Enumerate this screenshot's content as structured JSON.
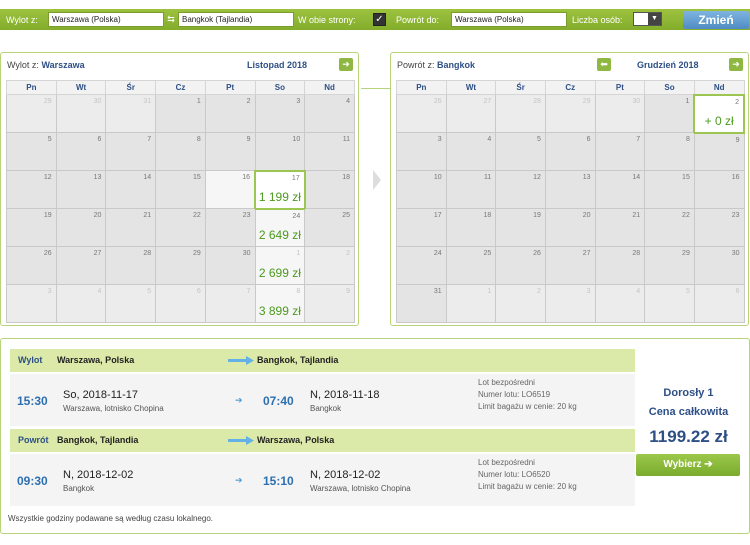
{
  "search": {
    "from_label": "Wylot z:",
    "from_value": "Warszawa (Polska)",
    "to_value": "Bangkok (Tajlandia)",
    "roundtrip_label": "W obie strony:",
    "roundtrip_checked": "✓",
    "return_label": "Powrót do:",
    "return_value": "Warszawa (Polska)",
    "persons_label": "Liczba osób:",
    "persons_value": "1",
    "submit_label": "Zmień"
  },
  "outbound_calendar": {
    "title_prefix": "Wylot z:",
    "city": "Warszawa",
    "month": "Listopad 2018",
    "weekdays": [
      "Pn",
      "Wt",
      "Śr",
      "Cz",
      "Pt",
      "So",
      "Nd"
    ],
    "weeks": [
      [
        {
          "d": "29",
          "dim": true
        },
        {
          "d": "30",
          "dim": true
        },
        {
          "d": "31",
          "dim": true
        },
        {
          "d": "1"
        },
        {
          "d": "2"
        },
        {
          "d": "3"
        },
        {
          "d": "4"
        }
      ],
      [
        {
          "d": "5"
        },
        {
          "d": "6"
        },
        {
          "d": "7"
        },
        {
          "d": "8"
        },
        {
          "d": "9"
        },
        {
          "d": "10"
        },
        {
          "d": "11"
        }
      ],
      [
        {
          "d": "12"
        },
        {
          "d": "13"
        },
        {
          "d": "14"
        },
        {
          "d": "15"
        },
        {
          "d": "16",
          "white": true
        },
        {
          "d": "17",
          "price": "1 199 zł",
          "sel": true
        },
        {
          "d": "18"
        }
      ],
      [
        {
          "d": "19"
        },
        {
          "d": "20"
        },
        {
          "d": "21"
        },
        {
          "d": "22"
        },
        {
          "d": "23"
        },
        {
          "d": "24",
          "price": "2 649 zł",
          "white": true
        },
        {
          "d": "25"
        }
      ],
      [
        {
          "d": "26"
        },
        {
          "d": "27"
        },
        {
          "d": "28"
        },
        {
          "d": "29"
        },
        {
          "d": "30"
        },
        {
          "d": "1",
          "price": "2 699 zł",
          "dim": true,
          "white": true
        },
        {
          "d": "2",
          "dim": true
        }
      ],
      [
        {
          "d": "3",
          "dim": true
        },
        {
          "d": "4",
          "dim": true
        },
        {
          "d": "5",
          "dim": true
        },
        {
          "d": "6",
          "dim": true
        },
        {
          "d": "7",
          "dim": true
        },
        {
          "d": "8",
          "price": "3 899 zł",
          "dim": true,
          "white": true
        },
        {
          "d": "9",
          "dim": true
        }
      ]
    ]
  },
  "return_calendar": {
    "title_prefix": "Powrót z:",
    "city": "Bangkok",
    "month": "Grudzień 2018",
    "weekdays": [
      "Pn",
      "Wt",
      "Śr",
      "Cz",
      "Pt",
      "So",
      "Nd"
    ],
    "weeks": [
      [
        {
          "d": "26",
          "dim": true
        },
        {
          "d": "27",
          "dim": true
        },
        {
          "d": "28",
          "dim": true
        },
        {
          "d": "29",
          "dim": true
        },
        {
          "d": "30",
          "dim": true
        },
        {
          "d": "1"
        },
        {
          "d": "2",
          "price": "+ 0 zł",
          "sel": true
        }
      ],
      [
        {
          "d": "3"
        },
        {
          "d": "4"
        },
        {
          "d": "5"
        },
        {
          "d": "6"
        },
        {
          "d": "7"
        },
        {
          "d": "8"
        },
        {
          "d": "9"
        }
      ],
      [
        {
          "d": "10"
        },
        {
          "d": "11"
        },
        {
          "d": "12"
        },
        {
          "d": "13"
        },
        {
          "d": "14"
        },
        {
          "d": "15"
        },
        {
          "d": "16"
        }
      ],
      [
        {
          "d": "17"
        },
        {
          "d": "18"
        },
        {
          "d": "19"
        },
        {
          "d": "20"
        },
        {
          "d": "21"
        },
        {
          "d": "22"
        },
        {
          "d": "23"
        }
      ],
      [
        {
          "d": "24"
        },
        {
          "d": "25"
        },
        {
          "d": "26"
        },
        {
          "d": "27"
        },
        {
          "d": "28"
        },
        {
          "d": "29"
        },
        {
          "d": "30"
        }
      ],
      [
        {
          "d": "31"
        },
        {
          "d": "1",
          "dim": true
        },
        {
          "d": "2",
          "dim": true
        },
        {
          "d": "3",
          "dim": true
        },
        {
          "d": "4",
          "dim": true
        },
        {
          "d": "5",
          "dim": true
        },
        {
          "d": "6",
          "dim": true
        }
      ]
    ]
  },
  "outbound": {
    "label": "Wylot",
    "from": "Warszawa, Polska",
    "to": "Bangkok, Tajlandia",
    "dep_time": "15:30",
    "dep_date": "So, 2018-11-17",
    "dep_place": "Warszawa, lotnisko Chopina",
    "arr_time": "07:40",
    "arr_date": "N, 2018-11-18",
    "arr_place": "Bangkok",
    "type": "Lot bezpośredni",
    "flight_no": "Numer lotu: LO6519",
    "baggage": "Limit bagażu w cenie: 20 kg"
  },
  "inbound": {
    "label": "Powrót",
    "from": "Bangkok, Tajlandia",
    "to": "Warszawa, Polska",
    "dep_time": "09:30",
    "dep_date": "N, 2018-12-02",
    "dep_place": "Bangkok",
    "arr_time": "15:10",
    "arr_date": "N, 2018-12-02",
    "arr_place": "Warszawa, lotnisko Chopina",
    "type": "Lot bezpośredni",
    "flight_no": "Numer lotu: LO6520",
    "baggage": "Limit bagażu w cenie: 20 kg"
  },
  "price": {
    "pax": "Dorosły 1",
    "total_label": "Cena całkowita",
    "total": "1199.22 zł",
    "select_label": "Wybierz"
  },
  "footer_note": "Wszystkie godziny podawane są według czasu lokalnego.",
  "colors": {
    "accent_green": "#8fb843",
    "brand_blue": "#2d4f86",
    "price_green": "#4c9a1e"
  }
}
